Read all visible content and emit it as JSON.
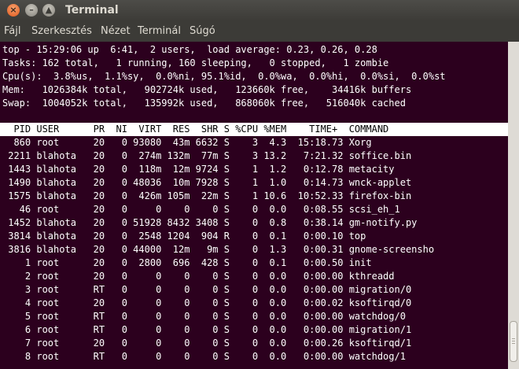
{
  "window": {
    "title": "Terminal"
  },
  "buttons": {
    "close": "×",
    "minimize": "–",
    "maximize": "▲"
  },
  "menu": [
    "Fájl",
    "Szerkesztés",
    "Nézet",
    "Terminál",
    "Súgó"
  ],
  "top_summary": [
    "top - 15:29:06 up  6:41,  2 users,  load average: 0.23, 0.26, 0.28",
    "Tasks: 162 total,   1 running, 160 sleeping,   0 stopped,   1 zombie",
    "Cpu(s):  3.8%us,  1.1%sy,  0.0%ni, 95.1%id,  0.0%wa,  0.0%hi,  0.0%si,  0.0%st",
    "Mem:   1026384k total,   902724k used,   123660k free,    34416k buffers",
    "Swap:  1004052k total,   135992k used,   868060k free,   516040k cached"
  ],
  "process_header": "  PID USER      PR  NI  VIRT  RES  SHR S %CPU %MEM    TIME+  COMMAND",
  "processes": [
    "  860 root      20   0 93080  43m 6632 S    3  4.3  15:18.73 Xorg",
    " 2211 blahota   20   0  274m 132m  77m S    3 13.2   7:21.32 soffice.bin",
    " 1443 blahota   20   0  118m  12m 9724 S    1  1.2   0:12.78 metacity",
    " 1490 blahota   20   0 48036  10m 7928 S    1  1.0   0:14.73 wnck-applet",
    " 1575 blahota   20   0  426m 105m  22m S    1 10.6  10:52.33 firefox-bin",
    "   46 root      20   0     0    0    0 S    0  0.0   0:08.55 scsi_eh_1",
    " 1452 blahota   20   0 51928 8432 3408 S    0  0.8   0:38.14 gm-notify.py",
    " 3814 blahota   20   0  2548 1204  904 R    0  0.1   0:00.10 top",
    " 3816 blahota   20   0 44000  12m   9m S    0  1.3   0:00.31 gnome-screensho",
    "    1 root      20   0  2800  696  428 S    0  0.1   0:00.50 init",
    "    2 root      20   0     0    0    0 S    0  0.0   0:00.00 kthreadd",
    "    3 root      RT   0     0    0    0 S    0  0.0   0:00.00 migration/0",
    "    4 root      20   0     0    0    0 S    0  0.0   0:00.02 ksoftirqd/0",
    "    5 root      RT   0     0    0    0 S    0  0.0   0:00.00 watchdog/0",
    "    6 root      RT   0     0    0    0 S    0  0.0   0:00.00 migration/1",
    "    7 root      20   0     0    0    0 S    0  0.0   0:00.26 ksoftirqd/1",
    "    8 root      RT   0     0    0    0 S    0  0.0   0:00.00 watchdog/1"
  ],
  "colors": {
    "terminal_bg": "#2c001e",
    "terminal_fg": "#ffffff",
    "titlebar_bg": "#3c3b37",
    "close_button": "#e2591d"
  }
}
